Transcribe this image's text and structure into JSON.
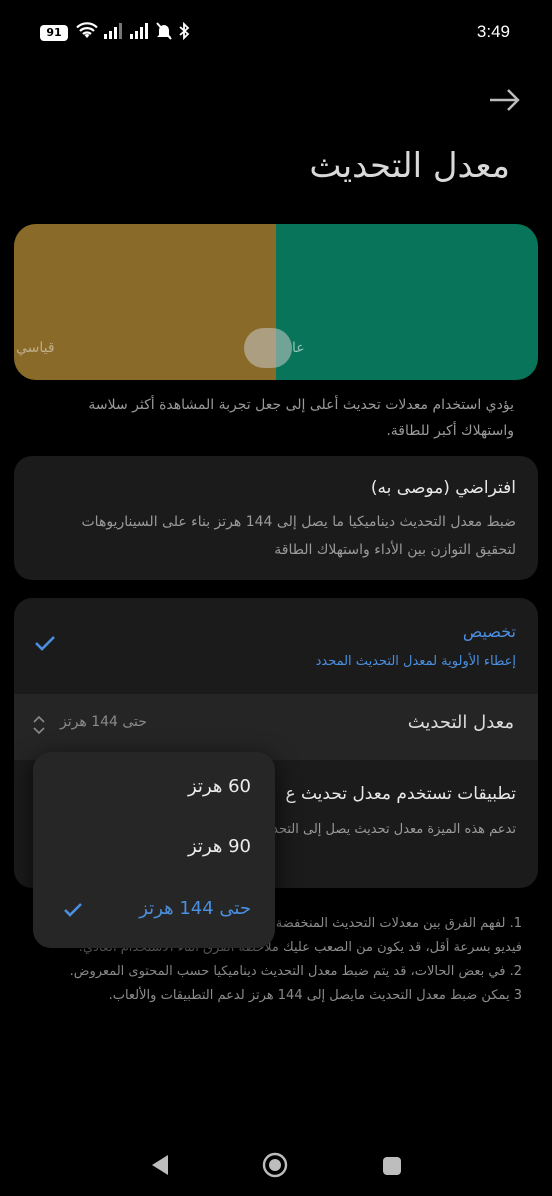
{
  "status_bar": {
    "battery": "91",
    "time": "3:49"
  },
  "header": {
    "title": "معدل التحديث"
  },
  "preview": {
    "standard_label": "قياسي",
    "high_label": "عا"
  },
  "description": "يؤدي استخدام معدلات تحديث أعلى إلى جعل تجربة المشاهدة أكثر سلاسة واستهلاك أكبر للطاقة.",
  "default_option": {
    "title": "افتراضي (موصى به)",
    "description": "ضبط معدل التحديث ديناميكيا ما يصل إلى 144 هرتز بناء على السيناريوهات لتحقيق التوازن بين الأداء واستهلاك الطاقة"
  },
  "custom_option": {
    "title": "تخصيص",
    "description": "إعطاء الأولوية لمعدل التحديث المحدد",
    "rate_label": "معدل التحديث",
    "rate_value": "حتى 144 هرتز",
    "apps_title": "تطبيقات تستخدم معدل تحديث ع",
    "apps_description": "تدعم هذه الميزة معدل تحديث يصل إلى التحديث المناسب تلقائيا بناء على تفضيلا"
  },
  "notes": [
    "1. لفهم الفرق بين معدلات التحديث المنخفضة",
    "فيديو بسرعة أقل، قد يكون من الصعب عليك ملاحظة الفرق أثناء الاستخدام العادي.",
    "2. في بعض الحالات، قد يتم ضبط معدل التحديث ديناميكيا حسب المحتوى المعروض.",
    "3 يمكن ضبط معدل التحديث مايصل إلى 144 هرتز لدعم التطبيقات والألعاب."
  ],
  "dropdown": {
    "options": [
      {
        "label": "60 هرتز",
        "selected": false
      },
      {
        "label": "90 هرتز",
        "selected": false
      },
      {
        "label": "حتى 144 هرتز",
        "selected": true
      }
    ]
  },
  "colors": {
    "accent": "#4a8fe0",
    "preview_standard": "#8a6a28",
    "preview_high": "#08755a"
  }
}
